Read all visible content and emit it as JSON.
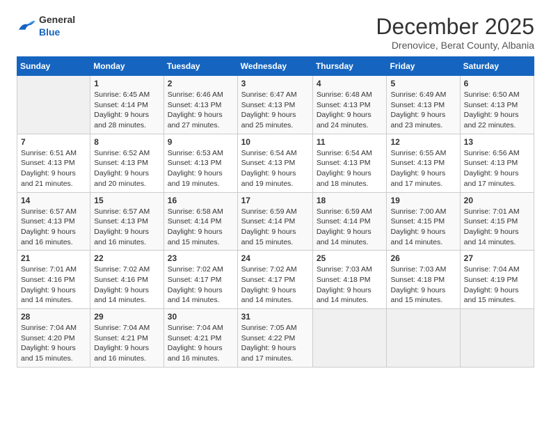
{
  "logo": {
    "general": "General",
    "blue": "Blue"
  },
  "header": {
    "month_title": "December 2025",
    "subtitle": "Drenovice, Berat County, Albania"
  },
  "days_of_week": [
    "Sunday",
    "Monday",
    "Tuesday",
    "Wednesday",
    "Thursday",
    "Friday",
    "Saturday"
  ],
  "weeks": [
    [
      {
        "day": "",
        "sunrise": "",
        "sunset": "",
        "daylight": ""
      },
      {
        "day": "1",
        "sunrise": "6:45 AM",
        "sunset": "4:14 PM",
        "hours": "9 hours and 28 minutes."
      },
      {
        "day": "2",
        "sunrise": "6:46 AM",
        "sunset": "4:13 PM",
        "hours": "9 hours and 27 minutes."
      },
      {
        "day": "3",
        "sunrise": "6:47 AM",
        "sunset": "4:13 PM",
        "hours": "9 hours and 25 minutes."
      },
      {
        "day": "4",
        "sunrise": "6:48 AM",
        "sunset": "4:13 PM",
        "hours": "9 hours and 24 minutes."
      },
      {
        "day": "5",
        "sunrise": "6:49 AM",
        "sunset": "4:13 PM",
        "hours": "9 hours and 23 minutes."
      },
      {
        "day": "6",
        "sunrise": "6:50 AM",
        "sunset": "4:13 PM",
        "hours": "9 hours and 22 minutes."
      }
    ],
    [
      {
        "day": "7",
        "sunrise": "6:51 AM",
        "sunset": "4:13 PM",
        "hours": "9 hours and 21 minutes."
      },
      {
        "day": "8",
        "sunrise": "6:52 AM",
        "sunset": "4:13 PM",
        "hours": "9 hours and 20 minutes."
      },
      {
        "day": "9",
        "sunrise": "6:53 AM",
        "sunset": "4:13 PM",
        "hours": "9 hours and 19 minutes."
      },
      {
        "day": "10",
        "sunrise": "6:54 AM",
        "sunset": "4:13 PM",
        "hours": "9 hours and 19 minutes."
      },
      {
        "day": "11",
        "sunrise": "6:54 AM",
        "sunset": "4:13 PM",
        "hours": "9 hours and 18 minutes."
      },
      {
        "day": "12",
        "sunrise": "6:55 AM",
        "sunset": "4:13 PM",
        "hours": "9 hours and 17 minutes."
      },
      {
        "day": "13",
        "sunrise": "6:56 AM",
        "sunset": "4:13 PM",
        "hours": "9 hours and 17 minutes."
      }
    ],
    [
      {
        "day": "14",
        "sunrise": "6:57 AM",
        "sunset": "4:13 PM",
        "hours": "9 hours and 16 minutes."
      },
      {
        "day": "15",
        "sunrise": "6:57 AM",
        "sunset": "4:13 PM",
        "hours": "9 hours and 16 minutes."
      },
      {
        "day": "16",
        "sunrise": "6:58 AM",
        "sunset": "4:14 PM",
        "hours": "9 hours and 15 minutes."
      },
      {
        "day": "17",
        "sunrise": "6:59 AM",
        "sunset": "4:14 PM",
        "hours": "9 hours and 15 minutes."
      },
      {
        "day": "18",
        "sunrise": "6:59 AM",
        "sunset": "4:14 PM",
        "hours": "9 hours and 14 minutes."
      },
      {
        "day": "19",
        "sunrise": "7:00 AM",
        "sunset": "4:15 PM",
        "hours": "9 hours and 14 minutes."
      },
      {
        "day": "20",
        "sunrise": "7:01 AM",
        "sunset": "4:15 PM",
        "hours": "9 hours and 14 minutes."
      }
    ],
    [
      {
        "day": "21",
        "sunrise": "7:01 AM",
        "sunset": "4:16 PM",
        "hours": "9 hours and 14 minutes."
      },
      {
        "day": "22",
        "sunrise": "7:02 AM",
        "sunset": "4:16 PM",
        "hours": "9 hours and 14 minutes."
      },
      {
        "day": "23",
        "sunrise": "7:02 AM",
        "sunset": "4:17 PM",
        "hours": "9 hours and 14 minutes."
      },
      {
        "day": "24",
        "sunrise": "7:02 AM",
        "sunset": "4:17 PM",
        "hours": "9 hours and 14 minutes."
      },
      {
        "day": "25",
        "sunrise": "7:03 AM",
        "sunset": "4:18 PM",
        "hours": "9 hours and 14 minutes."
      },
      {
        "day": "26",
        "sunrise": "7:03 AM",
        "sunset": "4:18 PM",
        "hours": "9 hours and 15 minutes."
      },
      {
        "day": "27",
        "sunrise": "7:04 AM",
        "sunset": "4:19 PM",
        "hours": "9 hours and 15 minutes."
      }
    ],
    [
      {
        "day": "28",
        "sunrise": "7:04 AM",
        "sunset": "4:20 PM",
        "hours": "9 hours and 15 minutes."
      },
      {
        "day": "29",
        "sunrise": "7:04 AM",
        "sunset": "4:21 PM",
        "hours": "9 hours and 16 minutes."
      },
      {
        "day": "30",
        "sunrise": "7:04 AM",
        "sunset": "4:21 PM",
        "hours": "9 hours and 16 minutes."
      },
      {
        "day": "31",
        "sunrise": "7:05 AM",
        "sunset": "4:22 PM",
        "hours": "9 hours and 17 minutes."
      },
      {
        "day": "",
        "sunrise": "",
        "sunset": "",
        "hours": ""
      },
      {
        "day": "",
        "sunrise": "",
        "sunset": "",
        "hours": ""
      },
      {
        "day": "",
        "sunrise": "",
        "sunset": "",
        "hours": ""
      }
    ]
  ],
  "labels": {
    "sunrise_prefix": "Sunrise: ",
    "sunset_prefix": "Sunset: ",
    "daylight_prefix": "Daylight: "
  }
}
